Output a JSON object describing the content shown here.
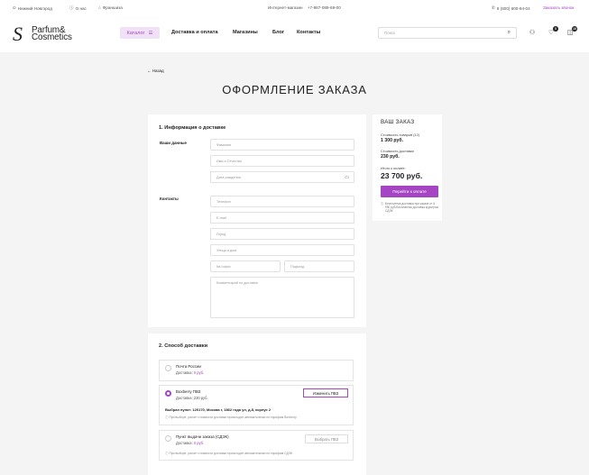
{
  "topbar": {
    "city": "Нижний Новгород",
    "about": "О нас",
    "franchise": "Франшиза",
    "store_label": "Интернет-магазин",
    "store_phone": "+7-987-089-69-00",
    "hotline": "8 (800) 600-94-04",
    "callback": "Заказать звонок"
  },
  "header": {
    "logo_mark": "S",
    "logo_line1": "Parfum&",
    "logo_line2": "Cosmetics",
    "catalog_label": "Каталог",
    "nav": [
      "Доставка и оплата",
      "Магазины",
      "Блог",
      "Контакты"
    ],
    "search_placeholder": "Поиск",
    "favorites_count": "0",
    "cart_count": "10"
  },
  "page": {
    "back_label": "← Назад",
    "title": "ОФОРМЛЕНИЕ ЗАКАЗА"
  },
  "info_section": {
    "title": "1. Информация о доставке",
    "your_data_label": "Ваши данные",
    "contacts_label": "Контакты",
    "fields": {
      "surname": "Фамилия",
      "name": "Имя и Отчество",
      "birthdate": "Дата рождения",
      "phone": "Телефон",
      "email": "E-mail",
      "city": "Город",
      "street": "Улица и дом",
      "apartment": "Кв./офис",
      "entrance": "Подъезд",
      "comment": "Комментарий по доставке"
    }
  },
  "summary": {
    "title": "ВАШ ЗАКАЗ",
    "goods_label": "Стоимость товаров (12)",
    "goods_value": "1 300 руб.",
    "delivery_label": "Стоимость доставки",
    "delivery_value": "230 руб.",
    "total_label": "Итого к оплате:",
    "total_value": "23 700 руб.",
    "pay_button": "Перейти к оплате",
    "note": "Бесплатная доставка при заказе от 6 990 руб.Бесплатная доставка курьером СДЭК"
  },
  "delivery_section": {
    "title": "2. Способ доставки",
    "options": [
      {
        "name": "Почта России",
        "cost_label": "Доставка:",
        "cost_value": "0 руб."
      },
      {
        "name": "Boxberry ПВЗ",
        "cost_label": "Доставка:",
        "cost_value": "230 руб.",
        "button": "Изменить ПВЗ",
        "selected_point": "Выбран пункт: 120170, Москва г, 1862 года ул, д.8, корпус 2",
        "note": "При выборе, расчет стоимости доставки происходит автоматически по тарифам Boxberry"
      },
      {
        "name": "Пункт выдачи заказа (СДЭК)",
        "cost_label": "Доставка:",
        "cost_value": "0 руб.",
        "button": "Выбрать ПВЗ",
        "note": "При выборе, расчет стоимости доставки происходит автоматически по тарифам СДЭК"
      }
    ]
  },
  "colors": {
    "accent": "#a545c4",
    "accent_light": "#f1e1f7",
    "background": "#f4f4f4"
  }
}
